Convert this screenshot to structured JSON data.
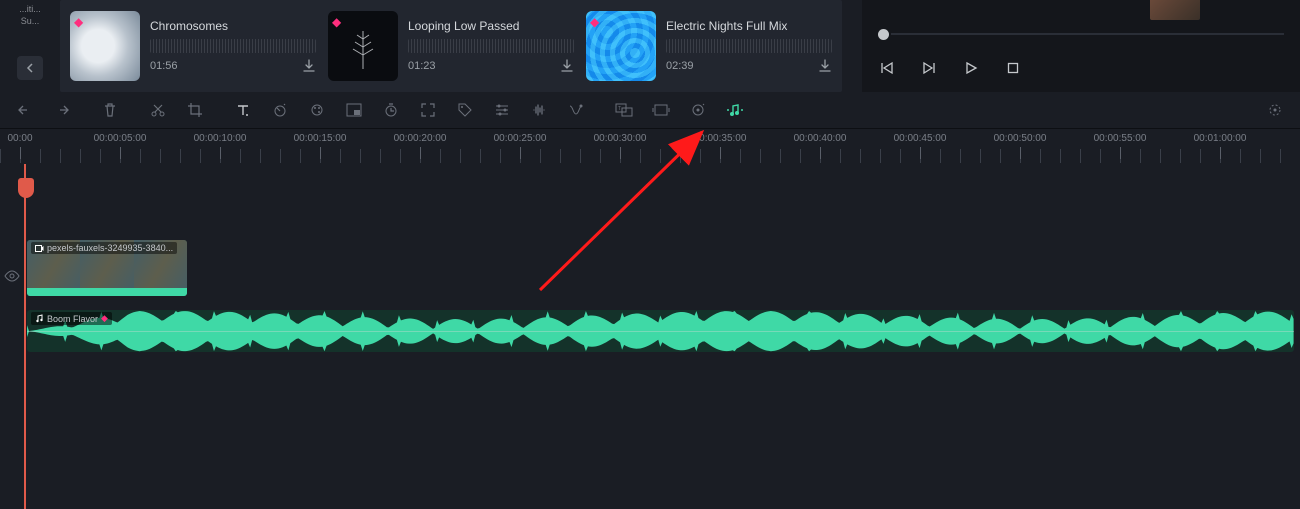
{
  "sidebar": {
    "label": "...iti...",
    "sub_label": "Su..."
  },
  "media": {
    "cards": [
      {
        "title": "Chromosomes",
        "duration": "01:56",
        "thumb": "clouds"
      },
      {
        "title": "Looping Low Passed",
        "duration": "01:23",
        "thumb": "plant"
      },
      {
        "title": "Electric Nights Full Mix",
        "duration": "02:39",
        "thumb": "water"
      }
    ]
  },
  "toolbar": {
    "buttons": [
      "undo",
      "redo",
      "delete",
      "split",
      "crop",
      "text",
      "speed",
      "color",
      "pip",
      "timer",
      "fit",
      "tag",
      "adjust",
      "audio-edit",
      "audio-detach",
      "subtitle",
      "frame",
      "smart",
      "beat-music"
    ]
  },
  "ruler": {
    "labels": [
      "00:00",
      "00:00:05:00",
      "00:00:10:00",
      "00:00:15:00",
      "00:00:20:00",
      "00:00:25:00",
      "00:00:30:00",
      "00:00:35:00",
      "00:00:40:00",
      "00:00:45:00",
      "00:00:50:00",
      "00:00:55:00",
      "00:01:00:00"
    ]
  },
  "timeline": {
    "video_clip": {
      "label": "pexels-fauxels-3249935-3840..."
    },
    "audio_clip": {
      "label": "Boom Flavor"
    }
  },
  "colors": {
    "accent": "#3fd9a6",
    "playhead": "#e05a4a",
    "gem": "#ff2e7e"
  }
}
